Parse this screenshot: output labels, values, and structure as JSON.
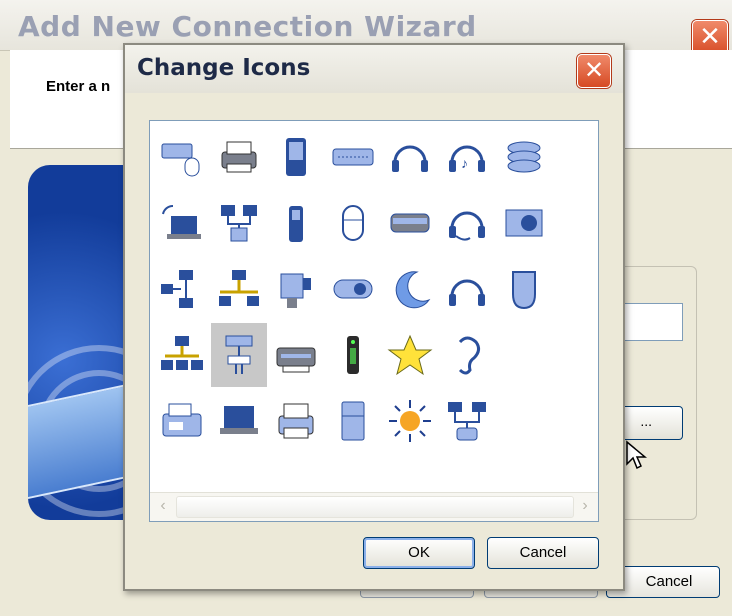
{
  "wizard": {
    "title": "Add New Connection Wizard",
    "prompt": "Enter a n",
    "change_button_label": "...",
    "cancel_label": "Cancel"
  },
  "dialog": {
    "title": "Change Icons",
    "ok_label": "OK",
    "cancel_label": "Cancel",
    "selected_icon": "hub-network-icon",
    "icons": [
      [
        "keyboard-mouse-icon",
        "printer-icon",
        "pda-icon",
        "keyboard-icon",
        "headphones-icon",
        "headphones-music-icon",
        "disks-icon"
      ],
      [
        "laptop-wireless-icon",
        "network-computers-icon",
        "cell-phone-icon",
        "mouse-icon",
        "scanner-icon",
        "headset-icon",
        "speaker-icon"
      ],
      [
        "network-hub-icon",
        "network-tree-icon",
        "projector-icon",
        "webcam-icon",
        "moon-icon",
        "headphones-simple-icon",
        "phone-handset-icon"
      ],
      [
        "network-computers-2-icon",
        "hub-network-icon",
        "printer-2-icon",
        "remote-control-icon",
        "star-icon",
        "ear-icon"
      ],
      [
        "fax-icon",
        "laptop-icon",
        "printer-3-icon",
        "fridge-icon",
        "sun-icon",
        "networked-computers-icon"
      ]
    ]
  },
  "colors": {
    "title_bar": "#e7e5dc",
    "dialog_bg": "#ece9d8",
    "close_button": "#d64a24",
    "selection": "#c8c8c8",
    "icon_blue": "#2a4f9c"
  }
}
